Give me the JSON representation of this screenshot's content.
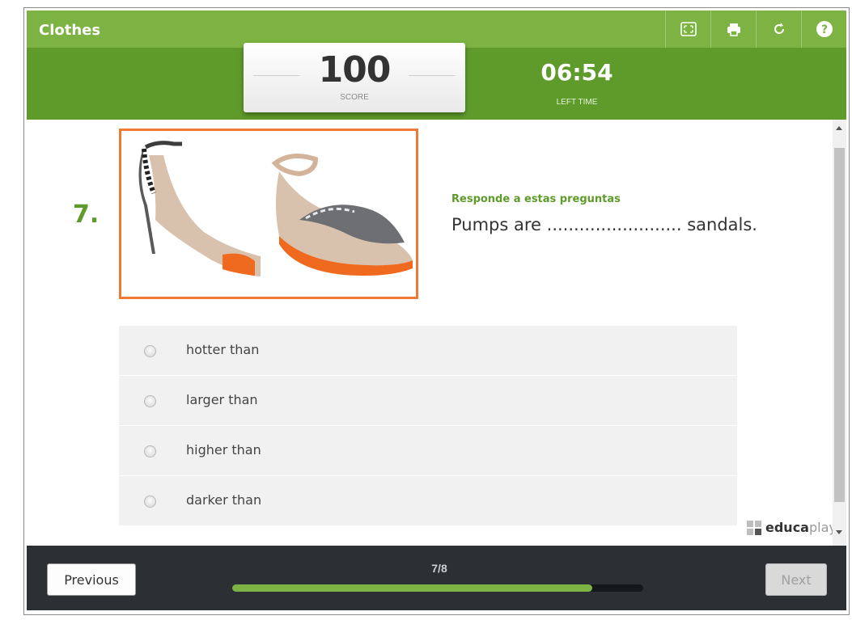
{
  "header": {
    "title": "Clothes",
    "icons": [
      "fullscreen-icon",
      "print-icon",
      "restart-icon",
      "help-icon"
    ]
  },
  "score": {
    "value": "100",
    "label": "SCORE"
  },
  "timer": {
    "value": "06:54",
    "label": "LEFT TIME"
  },
  "question": {
    "number": "7.",
    "instruction": "Responde a estas preguntas",
    "text": "Pumps are ......................... sandals.",
    "image": "shoes-image"
  },
  "answers": [
    {
      "label": "hotter than"
    },
    {
      "label": "larger than"
    },
    {
      "label": "higher than"
    },
    {
      "label": "darker than"
    }
  ],
  "brand": {
    "bold": "educa",
    "light": "play"
  },
  "footer": {
    "previous_label": "Previous",
    "next_label": "Next",
    "progress_text": "7/8",
    "progress_fraction": 0.875
  },
  "colors": {
    "green": "#7cb342",
    "dark_green": "#5f9b2b",
    "orange": "#ef7a35",
    "footer": "#2c2f34"
  }
}
